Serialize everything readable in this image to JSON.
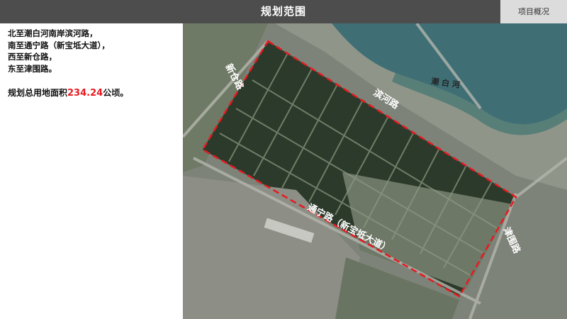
{
  "header": {
    "title": "规划范围",
    "tab": "项目概况"
  },
  "description": {
    "lines": [
      "北至潮白河南岸滨河路，",
      "南至通宁路（新宝坻大道），",
      "西至新仓路，",
      "东至津围路。"
    ],
    "area_prefix": "规划总用地面积",
    "area_value": "234.24",
    "area_unit": "公顷。"
  },
  "map": {
    "labels": {
      "river": "潮  白  河",
      "north_road": "滨河路",
      "west_road": "新仓路",
      "south_road": "通宁路（新宝坻大道）",
      "east_road": "津围路"
    },
    "colors": {
      "boundary": "#e8191f",
      "header": "#4d4d4d",
      "accent": "#e8191f"
    }
  }
}
